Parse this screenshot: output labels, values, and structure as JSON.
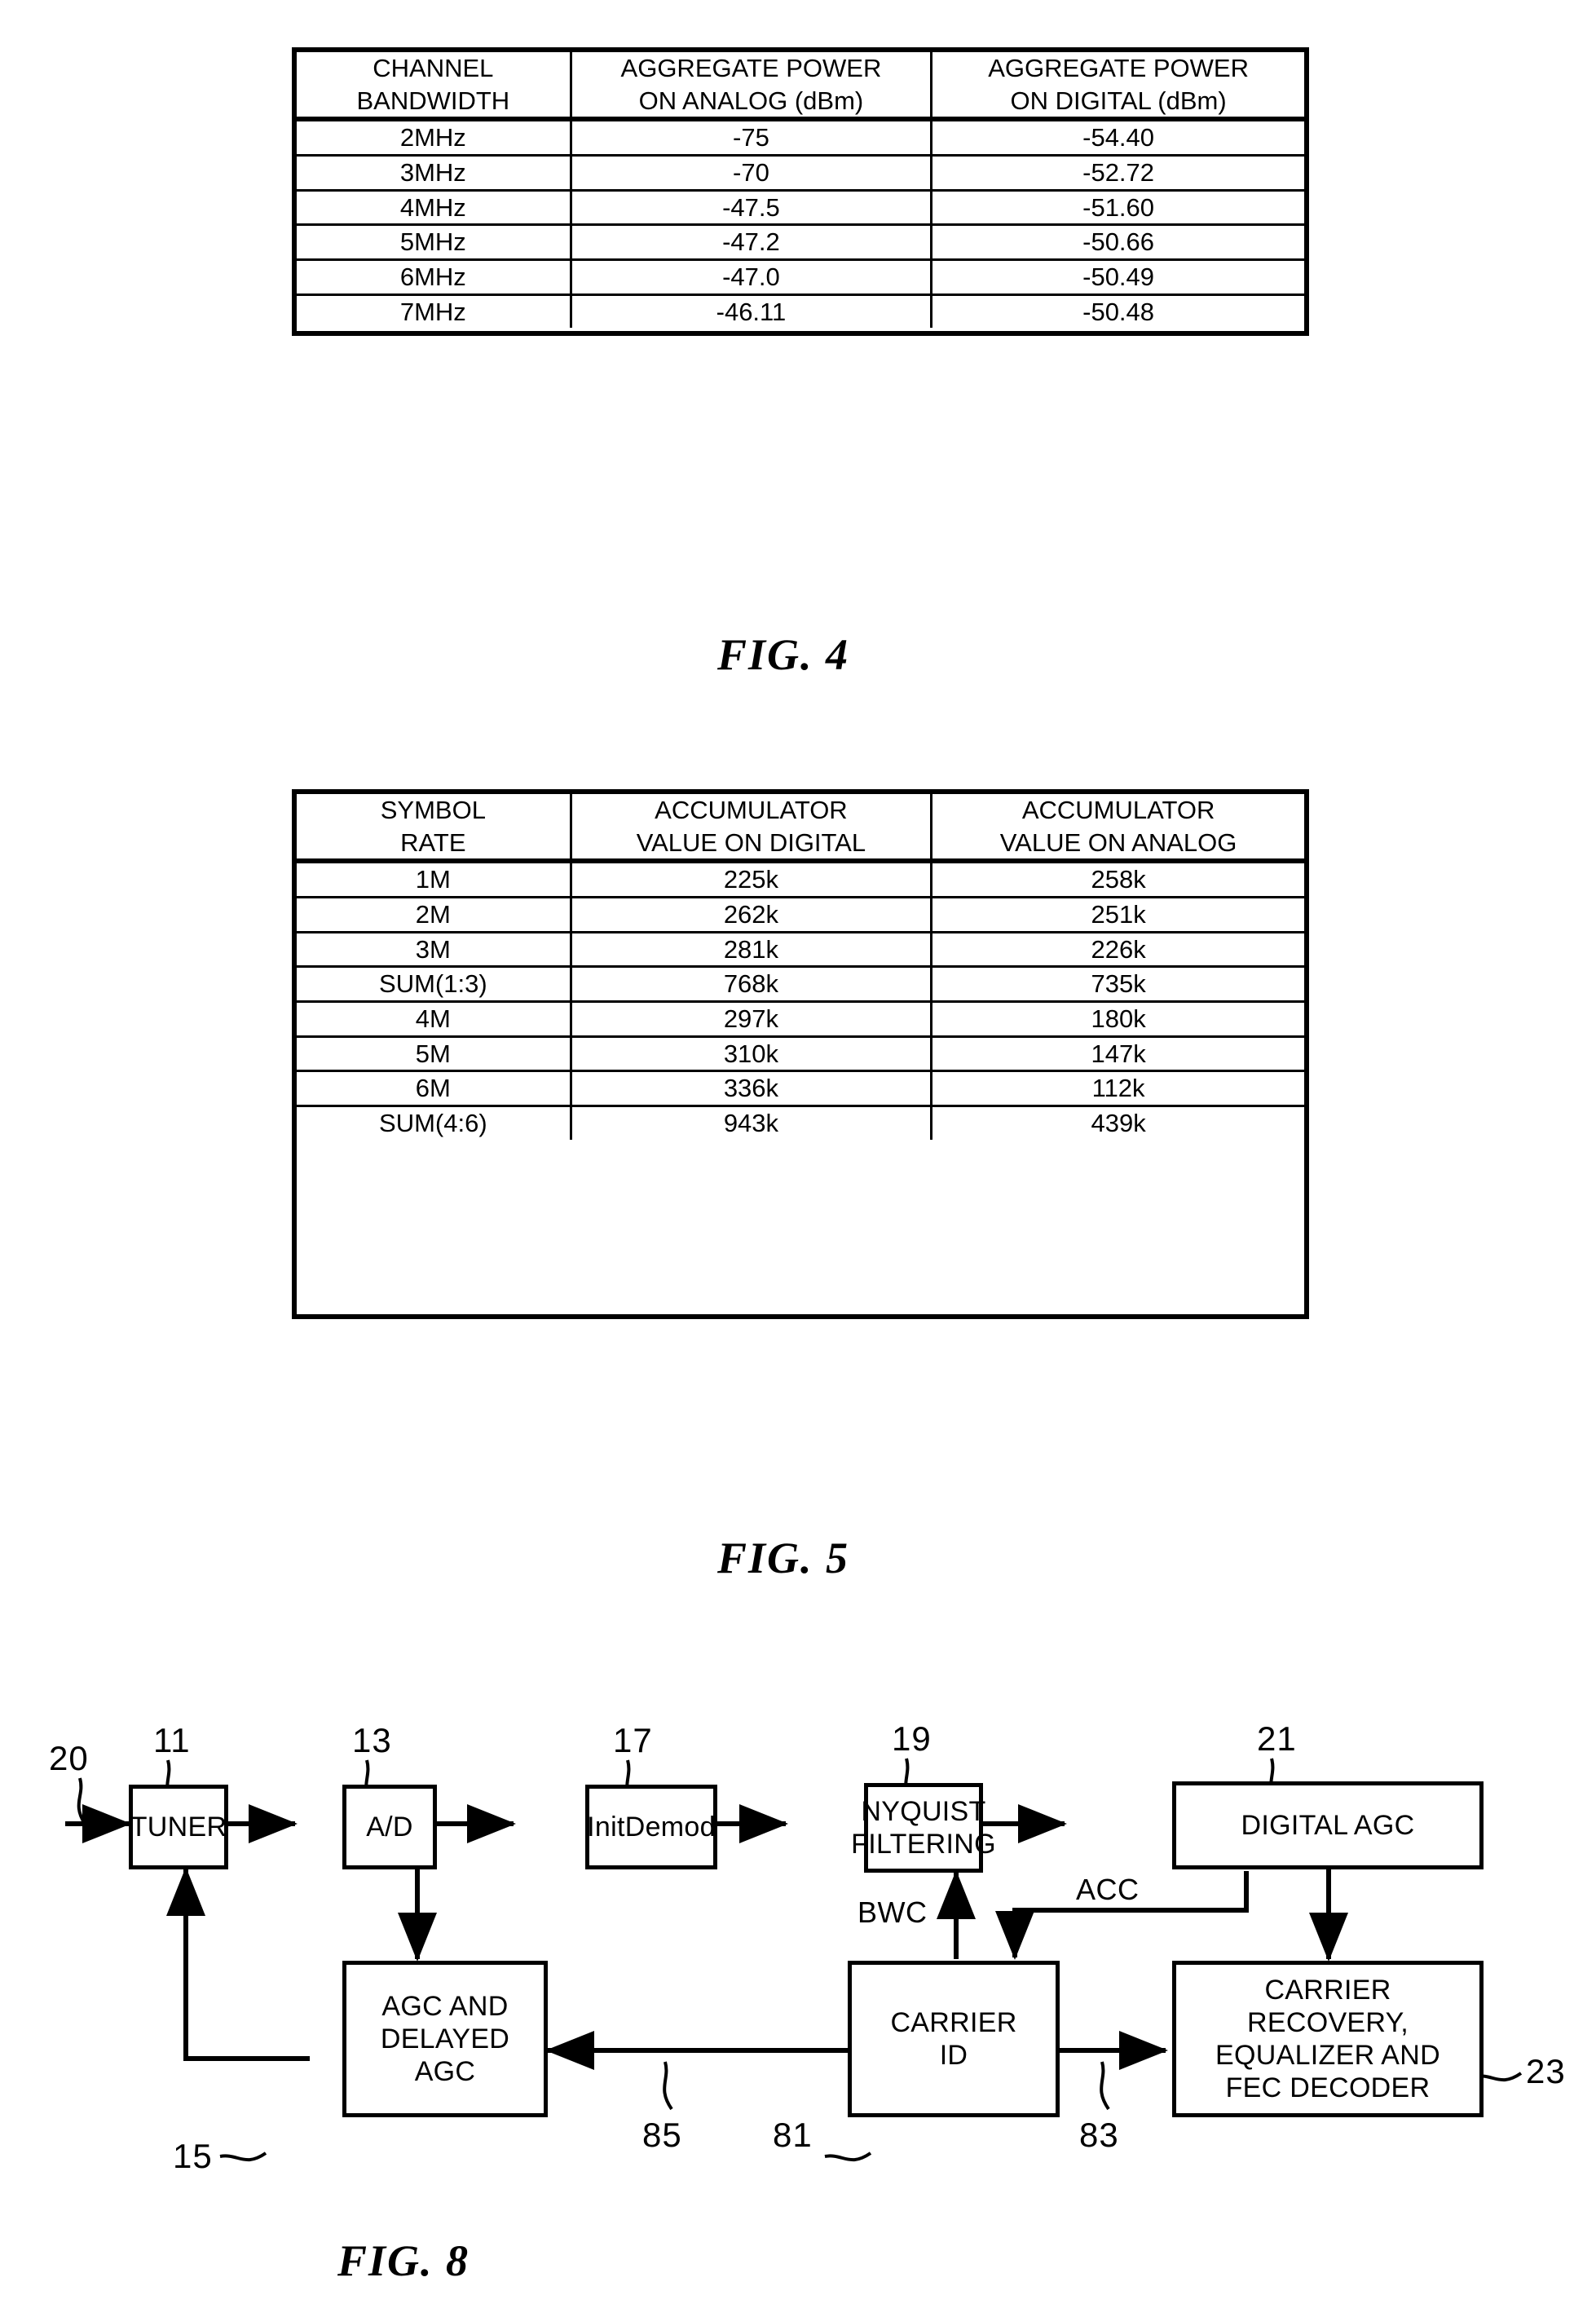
{
  "figures": [
    {
      "id": "fig4",
      "caption": "FIG. 4",
      "columns": [
        "CHANNEL\nBANDWIDTH",
        "AGGREGATE POWER\nON ANALOG (dBm)",
        "AGGREGATE POWER\nON DIGITAL (dBm)"
      ],
      "header": {
        "col1_line1": "CHANNEL",
        "col1_line2": "BANDWIDTH",
        "col2_line1": "AGGREGATE POWER",
        "col2_line2": "ON ANALOG (dBm)",
        "col3_line1": "AGGREGATE POWER",
        "col3_line2": "ON DIGITAL (dBm)"
      },
      "rows": [
        {
          "c1": "2MHz",
          "c2": "-75",
          "c3": "-54.40"
        },
        {
          "c1": "3MHz",
          "c2": "-70",
          "c3": "-52.72"
        },
        {
          "c1": "4MHz",
          "c2": "-47.5",
          "c3": "-51.60"
        },
        {
          "c1": "5MHz",
          "c2": "-47.2",
          "c3": "-50.66"
        },
        {
          "c1": "6MHz",
          "c2": "-47.0",
          "c3": "-50.49"
        },
        {
          "c1": "7MHz",
          "c2": "-46.11",
          "c3": "-50.48"
        }
      ]
    },
    {
      "id": "fig5",
      "caption": "FIG. 5",
      "header": {
        "col1_line1": "SYMBOL",
        "col1_line2": "RATE",
        "col2_line1": "ACCUMULATOR",
        "col2_line2": "VALUE ON DIGITAL",
        "col3_line1": "ACCUMULATOR",
        "col3_line2": "VALUE ON ANALOG"
      },
      "rows": [
        {
          "c1": "1M",
          "c2": "225k",
          "c3": "258k"
        },
        {
          "c1": "2M",
          "c2": "262k",
          "c3": "251k"
        },
        {
          "c1": "3M",
          "c2": "281k",
          "c3": "226k"
        },
        {
          "c1": "SUM(1:3)",
          "c2": "768k",
          "c3": "735k"
        },
        {
          "c1": "4M",
          "c2": "297k",
          "c3": "180k"
        },
        {
          "c1": "5M",
          "c2": "310k",
          "c3": "147k"
        },
        {
          "c1": "6M",
          "c2": "336k",
          "c3": "112k"
        },
        {
          "c1": "SUM(4:6)",
          "c2": "943k",
          "c3": "439k"
        }
      ]
    }
  ],
  "fig8": {
    "caption": "FIG. 8",
    "blocks": {
      "tuner": {
        "label": "TUNER",
        "ref": "11"
      },
      "adc": {
        "label": "A/D",
        "ref": "13"
      },
      "initdemod": {
        "label": "InitDemod",
        "ref": "17"
      },
      "nyquist": {
        "line1": "NYQUIST",
        "line2": "FILTERING",
        "ref": "19"
      },
      "digitalagc": {
        "label": "DIGITAL AGC",
        "ref": "21"
      },
      "agcdelayed": {
        "line1": "AGC AND",
        "line2": "DELAYED",
        "line3": "AGC",
        "ref": "15"
      },
      "carrierid": {
        "line1": "CARRIER",
        "line2": "ID",
        "ref": "81"
      },
      "recovery": {
        "line1": "CARRIER",
        "line2": "RECOVERY,",
        "line3": "EQUALIZER AND",
        "line4": "FEC DECODER",
        "ref": "23"
      }
    },
    "signals": {
      "input_ref": "20",
      "bwc": "BWC",
      "acc": "ACC",
      "ref85": "85",
      "ref83": "83"
    }
  },
  "colors": {
    "ink": "#000000",
    "paper": "#ffffff"
  }
}
